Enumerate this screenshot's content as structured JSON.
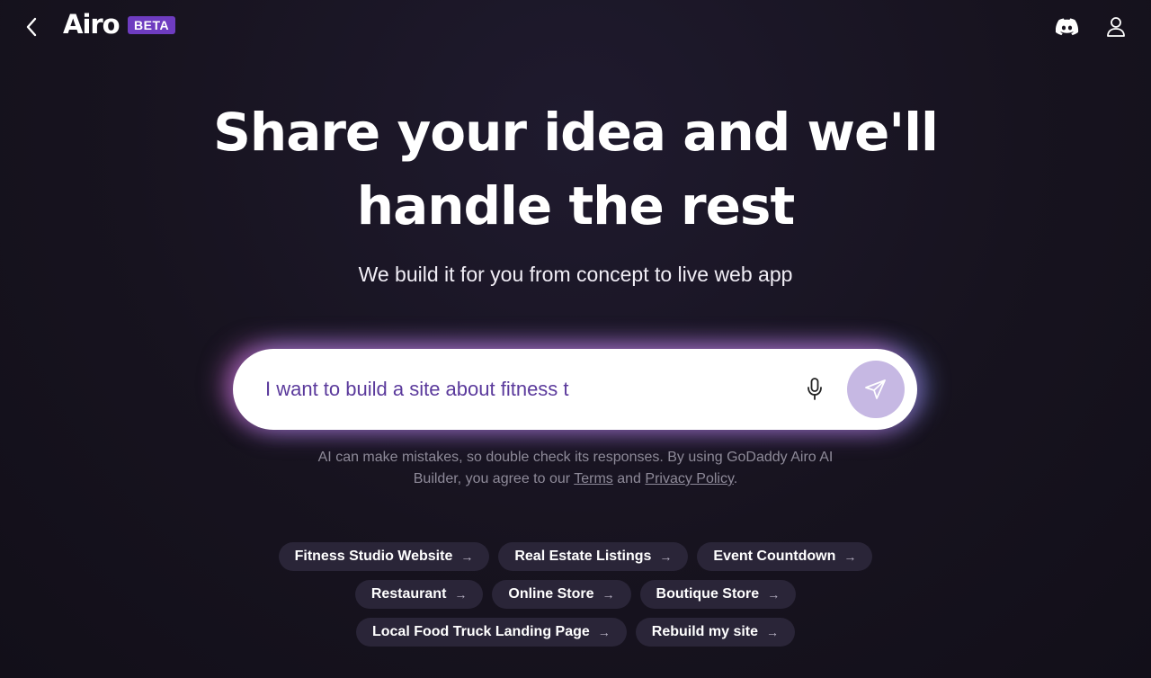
{
  "header": {
    "logo_text": "Airo",
    "beta_label": "BETA",
    "back_icon": "chevron-left-icon",
    "discord_icon": "discord-icon",
    "account_icon": "user-icon"
  },
  "hero": {
    "headline_line1": "Share your idea and we'll",
    "headline_line2": "handle the rest",
    "subheadline": "We build it for you from concept to live web app"
  },
  "prompt": {
    "value": "I want to build a site about fitness t",
    "mic_icon": "microphone-icon",
    "send_icon": "send-icon",
    "send_color": "#c6b8e3"
  },
  "disclaimer": {
    "text_before": "AI can make mistakes, so double check its responses. By using GoDaddy Airo AI Builder, you agree to our ",
    "terms_link": "Terms",
    "and_text": " and ",
    "privacy_link": "Privacy Policy",
    "period": "."
  },
  "suggestions": [
    [
      "Fitness Studio Website",
      "Real Estate Listings",
      "Event Countdown"
    ],
    [
      "Restaurant",
      "Online Store",
      "Boutique Store"
    ],
    [
      "Local Food Truck Landing Page",
      "Rebuild my site"
    ]
  ],
  "suggestion_arrow": "→",
  "colors": {
    "background": "#17131f",
    "accent": "#6e3cc0",
    "chip_bg": "#2a2538",
    "input_text": "#5b3a9c"
  }
}
